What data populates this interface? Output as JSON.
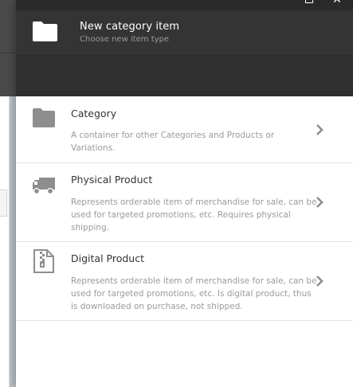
{
  "window": {
    "maximize_icon": "maximize-icon",
    "close_icon": "close-icon",
    "close_label": "✕"
  },
  "header": {
    "icon": "folder-icon",
    "title": "New category item",
    "subtitle": "Choose new item type"
  },
  "items": [
    {
      "icon": "folder-icon",
      "title": "Category",
      "description": "A container for other Categories and Products or Variations."
    },
    {
      "icon": "truck-icon",
      "title": "Physical Product",
      "description": "Represents orderable item of merchandise for sale, can be used for targeted promotions, etc. Requires physical shipping."
    },
    {
      "icon": "zip-file-icon",
      "title": "Digital Product",
      "description": "Represents orderable item of merchandise for sale, can be used for targeted promotions, etc. Is digital product, thus is downloaded on purchase, not shipped."
    }
  ],
  "colors": {
    "header_bg": "#2f2f2f",
    "blade_bg": "#ffffff",
    "icon_gray": "#8e8e8e",
    "title_text": "#333333",
    "desc_text": "#9a9a9a"
  }
}
